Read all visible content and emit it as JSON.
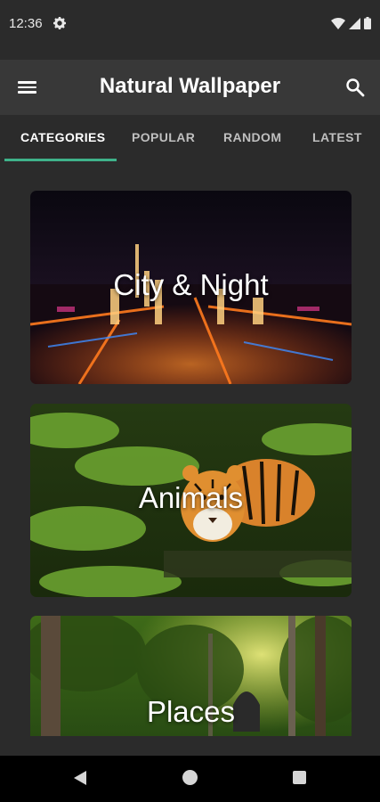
{
  "status": {
    "time": "12:36",
    "icons": [
      "gear-icon",
      "wifi-icon",
      "signal-icon",
      "battery-icon"
    ]
  },
  "app_bar": {
    "title": "Natural Wallpaper",
    "menu_icon": "hamburger-menu-icon",
    "search_icon": "search-icon"
  },
  "tabs": [
    {
      "label": "CATEGORIES",
      "active": true
    },
    {
      "label": "POPULAR",
      "active": false
    },
    {
      "label": "RANDOM",
      "active": false
    },
    {
      "label": "LATEST",
      "active": false
    }
  ],
  "categories": [
    {
      "label": "City & Night"
    },
    {
      "label": "Animals"
    },
    {
      "label": "Places"
    }
  ],
  "colors": {
    "accent": "#3fb28a",
    "background": "#2b2b2b",
    "app_bar": "#383838"
  },
  "nav": {
    "back": "back-icon",
    "home": "home-icon",
    "recents": "recents-icon"
  }
}
